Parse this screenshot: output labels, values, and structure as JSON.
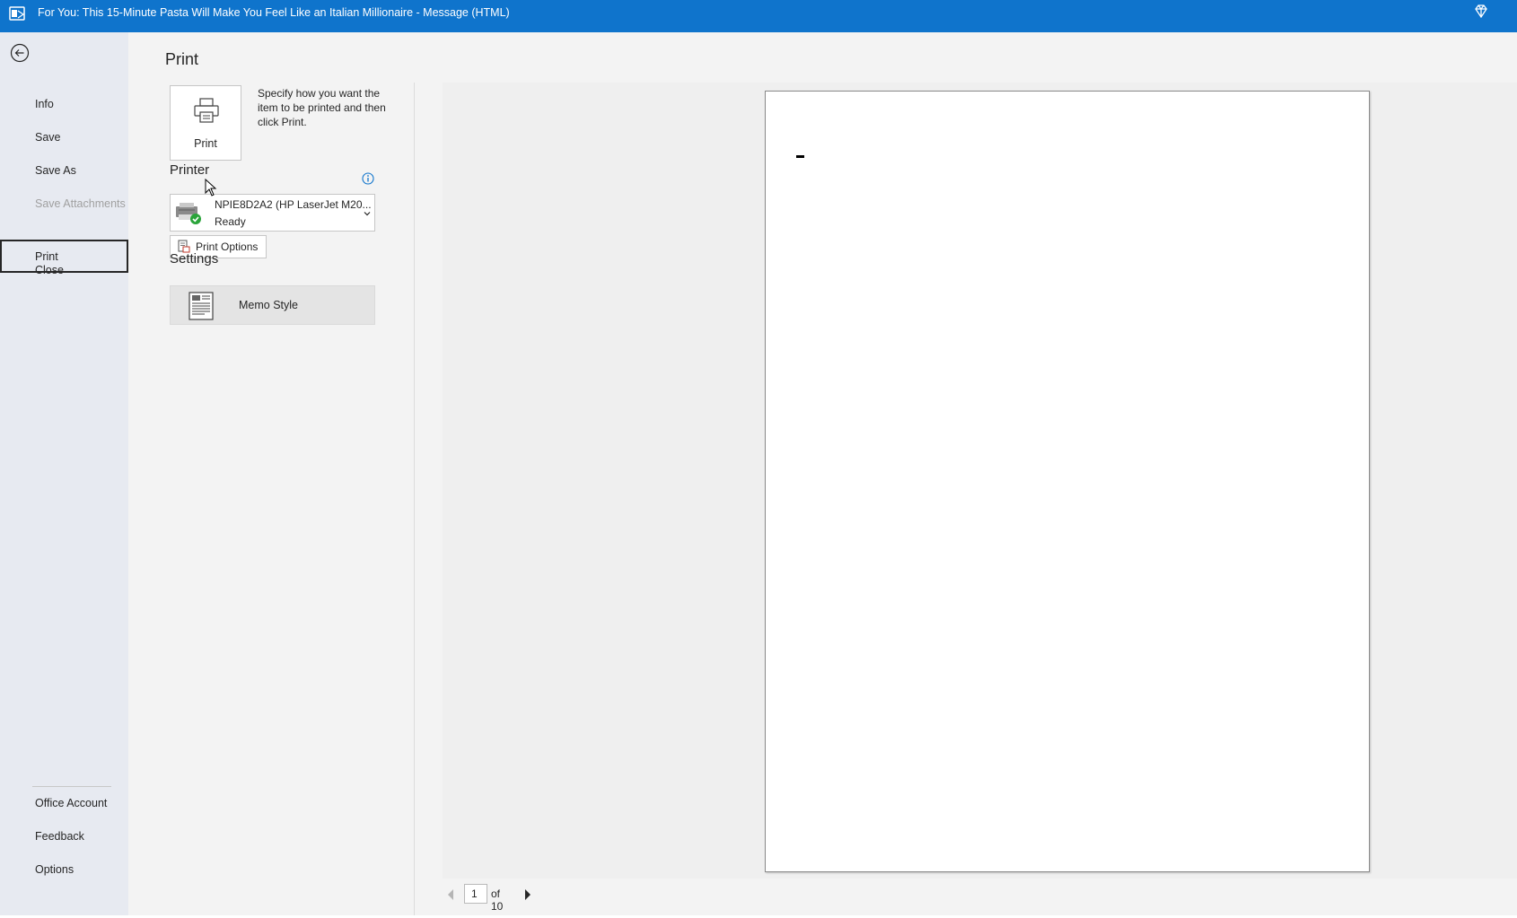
{
  "window": {
    "title": "For You: This 15-Minute Pasta Will Make You Feel Like an Italian Millionaire  -  Message (HTML)"
  },
  "nav": {
    "items": [
      {
        "label": "Info",
        "disabled": false
      },
      {
        "label": "Save",
        "disabled": false
      },
      {
        "label": "Save As",
        "disabled": false
      },
      {
        "label": "Save Attachments",
        "disabled": true
      },
      {
        "label": "Print",
        "selected": true
      },
      {
        "label": "Close",
        "disabled": false
      }
    ],
    "bottom_items": [
      {
        "label": "Office Account"
      },
      {
        "label": "Feedback"
      },
      {
        "label": "Options"
      }
    ]
  },
  "print": {
    "title": "Print",
    "button_label": "Print",
    "help_text": "Specify how you want the item to be printed and then click Print.",
    "printer_section_label": "Printer",
    "printer": {
      "name": "NPIE8D2A2 (HP LaserJet M20...",
      "status": "Ready"
    },
    "print_options_label": "Print Options",
    "settings_label": "Settings",
    "style": "Memo Style"
  },
  "preview": {
    "current_page": "1",
    "total_pages_text": "of 10"
  },
  "colors": {
    "titlebar": "#0f74cc",
    "nav_background": "#e7eaf1",
    "main_background": "#f3f3f3"
  }
}
